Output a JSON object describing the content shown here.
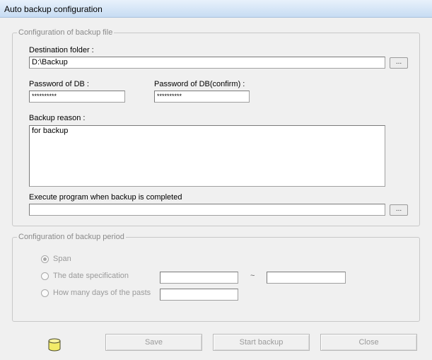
{
  "window": {
    "title": "Auto backup configuration"
  },
  "file_group": {
    "legend": "Configuration of backup file",
    "destination_label": "Destination folder :",
    "destination_value": "D:\\Backup",
    "browse_label": "...",
    "password_label": "Password of DB :",
    "password_value": "**********",
    "password_confirm_label": "Password of DB(confirm) :",
    "password_confirm_value": "**********",
    "reason_label": "Backup reason :",
    "reason_value": "for backup",
    "execute_label": "Execute program when backup is completed",
    "execute_value": "",
    "execute_browse_label": "..."
  },
  "period_group": {
    "legend": "Configuration of backup period",
    "span_label": "Span",
    "span_selected": true,
    "date_spec_label": "The date specification",
    "date_from": "",
    "date_separator": "~",
    "date_to": "",
    "days_label": "How many days of the pasts",
    "days_value": ""
  },
  "footer": {
    "db_icon": "database-icon",
    "db_icon_color": "#f3ec68",
    "save_label": "Save",
    "start_label": "Start backup",
    "close_label": "Close"
  }
}
